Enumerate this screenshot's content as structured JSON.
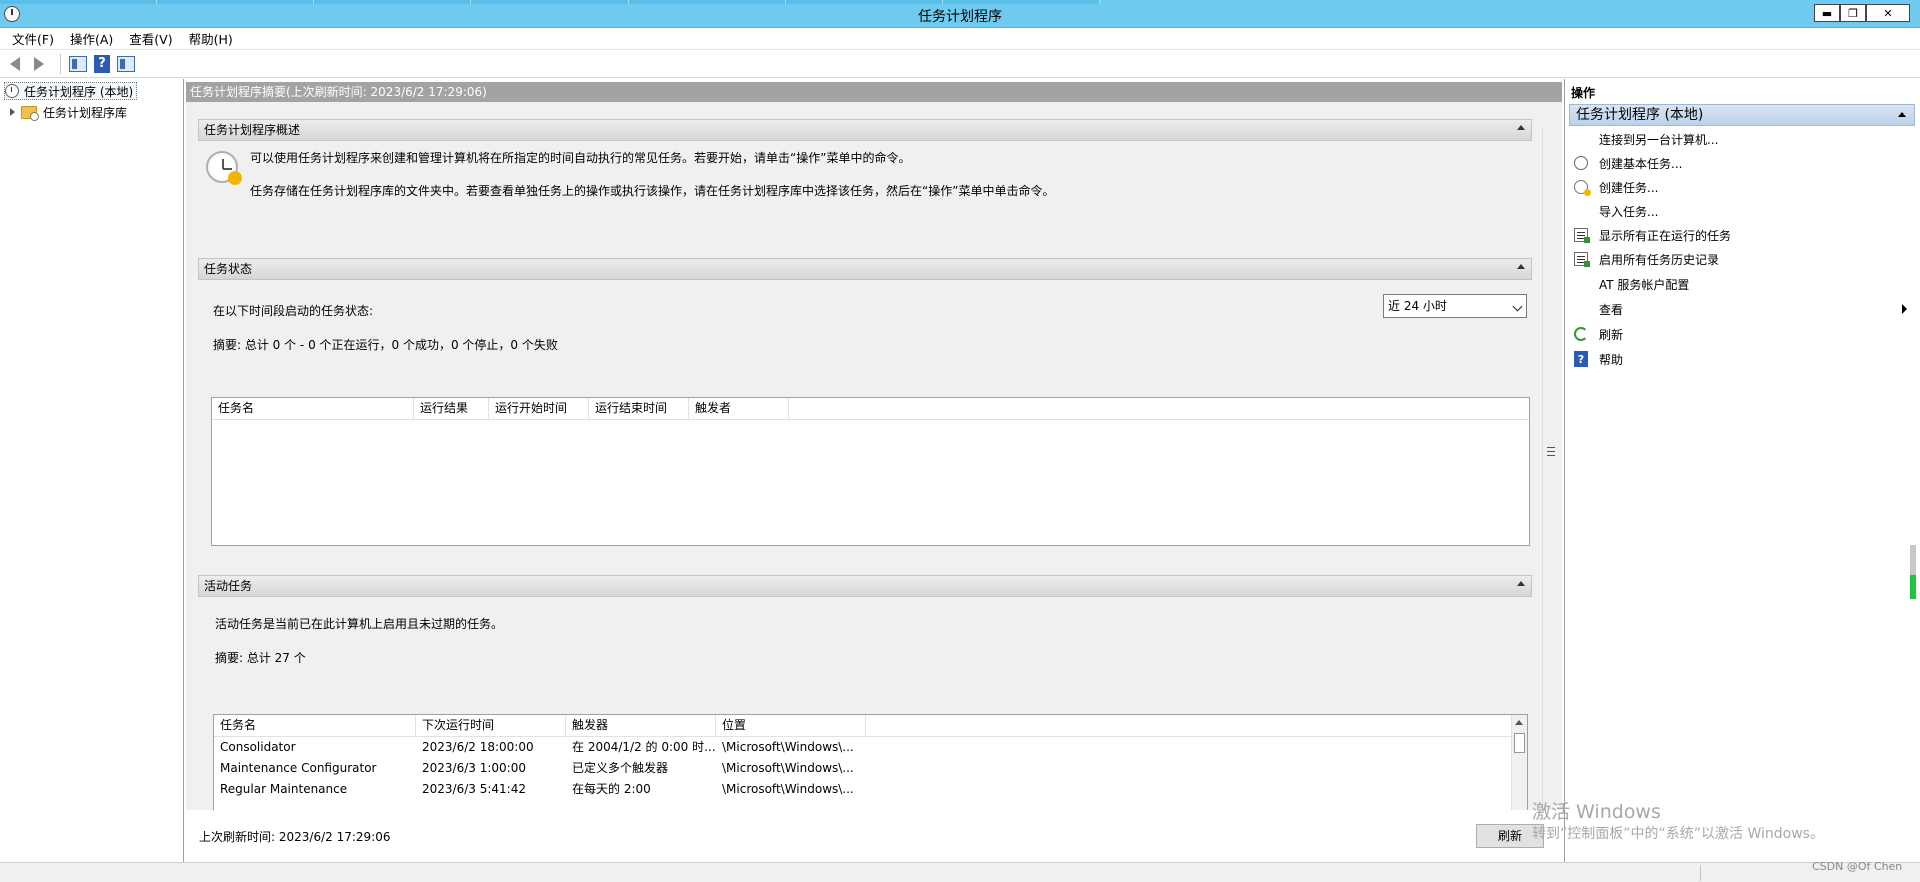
{
  "window": {
    "title": "任务计划程序",
    "minimize": "▬",
    "restore": "❐",
    "close": "✕"
  },
  "menu": [
    "文件(F)",
    "操作(A)",
    "查看(V)",
    "帮助(H)"
  ],
  "tree": {
    "root": "任务计划程序 (本地)",
    "library": "任务计划程序库"
  },
  "center": {
    "header": "任务计划程序摘要(上次刷新时间: 2023/6/2 17:29:06)",
    "overview": {
      "title": "任务计划程序概述",
      "line1": "可以使用任务计划程序来创建和管理计算机将在所指定的时间自动执行的常见任务。若要开始，请单击“操作”菜单中的命令。",
      "line2": "任务存储在任务计划程序库的文件夹中。若要查看单独任务上的操作或执行该操作，请在任务计划程序库中选择该任务，然后在“操作”菜单中单击命令。"
    },
    "status": {
      "title": "任务状态",
      "period_label": "在以下时间段启动的任务状态:",
      "period_value": "近 24 小时",
      "summary": "摘要: 总计 0 个 - 0 个正在运行，0 个成功，0 个停止，0 个失败",
      "columns": [
        "任务名",
        "运行结果",
        "运行开始时间",
        "运行结束时间",
        "触发者"
      ]
    },
    "active": {
      "title": "活动任务",
      "desc": "活动任务是当前已在此计算机上启用且未过期的任务。",
      "summary": "摘要: 总计 27 个",
      "columns": [
        "任务名",
        "下次运行时间",
        "触发器",
        "位置"
      ],
      "rows": [
        [
          "Consolidator",
          "2023/6/2 18:00:00",
          "在 2004/1/2 的 0:00 时...",
          "\\Microsoft\\Windows\\..."
        ],
        [
          "Maintenance Configurator",
          "2023/6/3 1:00:00",
          "已定义多个触发器",
          "\\Microsoft\\Windows\\..."
        ],
        [
          "Regular Maintenance",
          "2023/6/3 5:41:42",
          "在每天的 2:00",
          "\\Microsoft\\Windows\\..."
        ]
      ]
    },
    "footer": {
      "last_refresh": "上次刷新时间: 2023/6/2 17:29:06",
      "refresh_button": "刷新"
    }
  },
  "actions": {
    "title": "操作",
    "group": "任务计划程序 (本地)",
    "items": [
      {
        "label": "连接到另一台计算机...",
        "icon": ""
      },
      {
        "label": "创建基本任务...",
        "icon": "clock-icon"
      },
      {
        "label": "创建任务...",
        "icon": "create-task-icon"
      },
      {
        "label": "导入任务...",
        "icon": ""
      },
      {
        "label": "显示所有正在运行的任务",
        "icon": "running-tasks-icon"
      },
      {
        "label": "启用所有任务历史记录",
        "icon": "history-icon"
      },
      {
        "label": "AT 服务帐户配置",
        "icon": ""
      },
      {
        "label": "查看",
        "icon": ""
      },
      {
        "label": "刷新",
        "icon": "refresh-icon"
      },
      {
        "label": "帮助",
        "icon": "help-icon"
      }
    ]
  },
  "watermark": {
    "line1": "激活 Windows",
    "line2": "转到“控制面板”中的“系统”以激活 Windows。",
    "credit": "CSDN @Of Chen"
  }
}
